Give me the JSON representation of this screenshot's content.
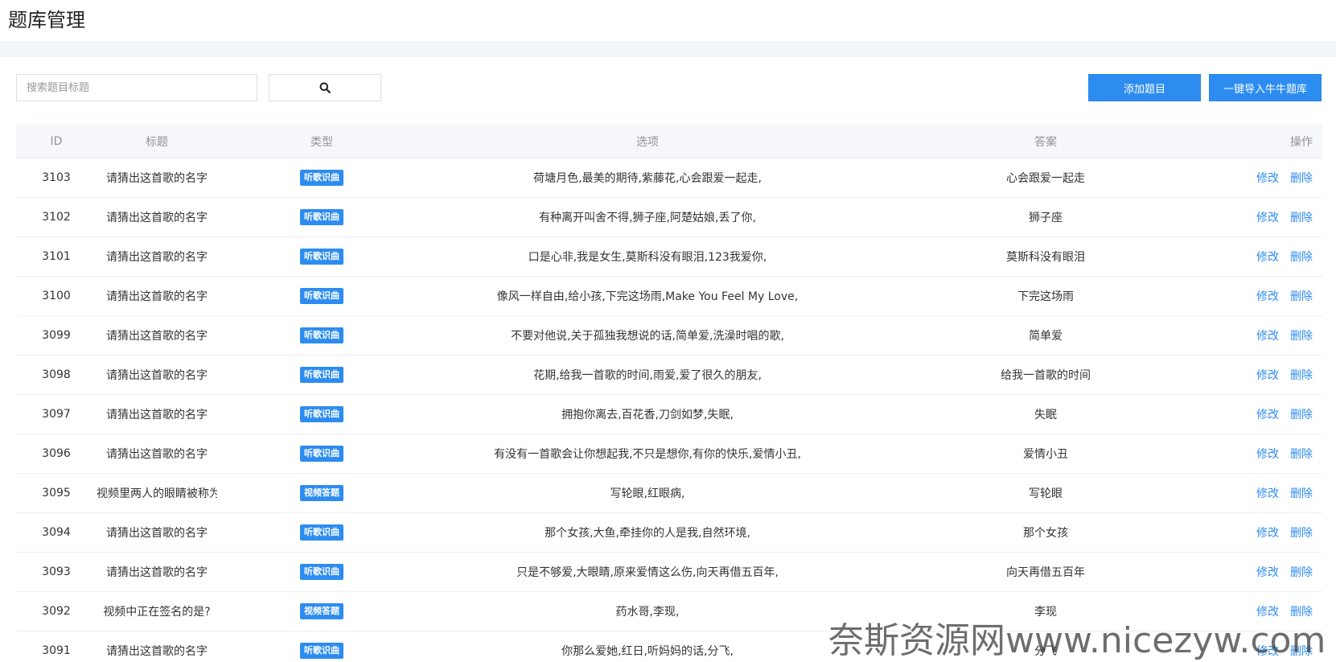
{
  "page": {
    "title": "题库管理"
  },
  "toolbar": {
    "search_placeholder": "搜索题目标题",
    "search_icon": "search-icon",
    "add_label": "添加题目",
    "import_label": "一键导入牛牛题库"
  },
  "colors": {
    "accent": "#2d8cf0",
    "header_bg": "#f5f7fa",
    "band_bg": "#f4f5f7"
  },
  "table": {
    "headers": {
      "id": "ID",
      "title": "标题",
      "type": "类型",
      "options": "选项",
      "answer": "答案",
      "actions": "操作"
    },
    "action_edit": "修改",
    "action_delete": "删除",
    "rows": [
      {
        "id": "3103",
        "title": "请猜出这首歌的名字",
        "type": "听歌识曲",
        "options": "荷塘月色,最美的期待,紫藤花,心会跟爱一起走,",
        "answer": "心会跟爱一起走"
      },
      {
        "id": "3102",
        "title": "请猜出这首歌的名字",
        "type": "听歌识曲",
        "options": "有种离开叫舍不得,狮子座,阿楚姑娘,丢了你,",
        "answer": "狮子座"
      },
      {
        "id": "3101",
        "title": "请猜出这首歌的名字",
        "type": "听歌识曲",
        "options": "口是心非,我是女生,莫斯科没有眼泪,123我爱你,",
        "answer": "莫斯科没有眼泪"
      },
      {
        "id": "3100",
        "title": "请猜出这首歌的名字",
        "type": "听歌识曲",
        "options": "像风一样自由,给小孩,下完这场雨,Make You Feel My Love,",
        "answer": "下完这场雨"
      },
      {
        "id": "3099",
        "title": "请猜出这首歌的名字",
        "type": "听歌识曲",
        "options": "不要对他说,关于孤独我想说的话,简单爱,洗澡时唱的歌,",
        "answer": "简单爱"
      },
      {
        "id": "3098",
        "title": "请猜出这首歌的名字",
        "type": "听歌识曲",
        "options": "花期,给我一首歌的时间,雨爱,爱了很久的朋友,",
        "answer": "给我一首歌的时间"
      },
      {
        "id": "3097",
        "title": "请猜出这首歌的名字",
        "type": "听歌识曲",
        "options": "拥抱你离去,百花香,刀剑如梦,失眠,",
        "answer": "失眠"
      },
      {
        "id": "3096",
        "title": "请猜出这首歌的名字",
        "type": "听歌识曲",
        "options": "有没有一首歌会让你想起我,不只是想你,有你的快乐,爱情小丑,",
        "answer": "爱情小丑"
      },
      {
        "id": "3095",
        "title": "视频里两人的眼睛被称为?",
        "type": "视频答题",
        "options": "写轮眼,红眼病,",
        "answer": "写轮眼"
      },
      {
        "id": "3094",
        "title": "请猜出这首歌的名字",
        "type": "听歌识曲",
        "options": "那个女孩,大鱼,牵挂你的人是我,自然环境,",
        "answer": "那个女孩"
      },
      {
        "id": "3093",
        "title": "请猜出这首歌的名字",
        "type": "听歌识曲",
        "options": "只是不够爱,大眼睛,原来爱情这么伤,向天再借五百年,",
        "answer": "向天再借五百年"
      },
      {
        "id": "3092",
        "title": "视频中正在签名的是?",
        "type": "视频答题",
        "options": "药水哥,李现,",
        "answer": "李现"
      },
      {
        "id": "3091",
        "title": "请猜出这首歌的名字",
        "type": "听歌识曲",
        "options": "你那么爱她,红日,听妈妈的话,分飞,",
        "answer": "分飞"
      }
    ]
  },
  "watermark": "奈斯资源网www.nicezyw.com"
}
